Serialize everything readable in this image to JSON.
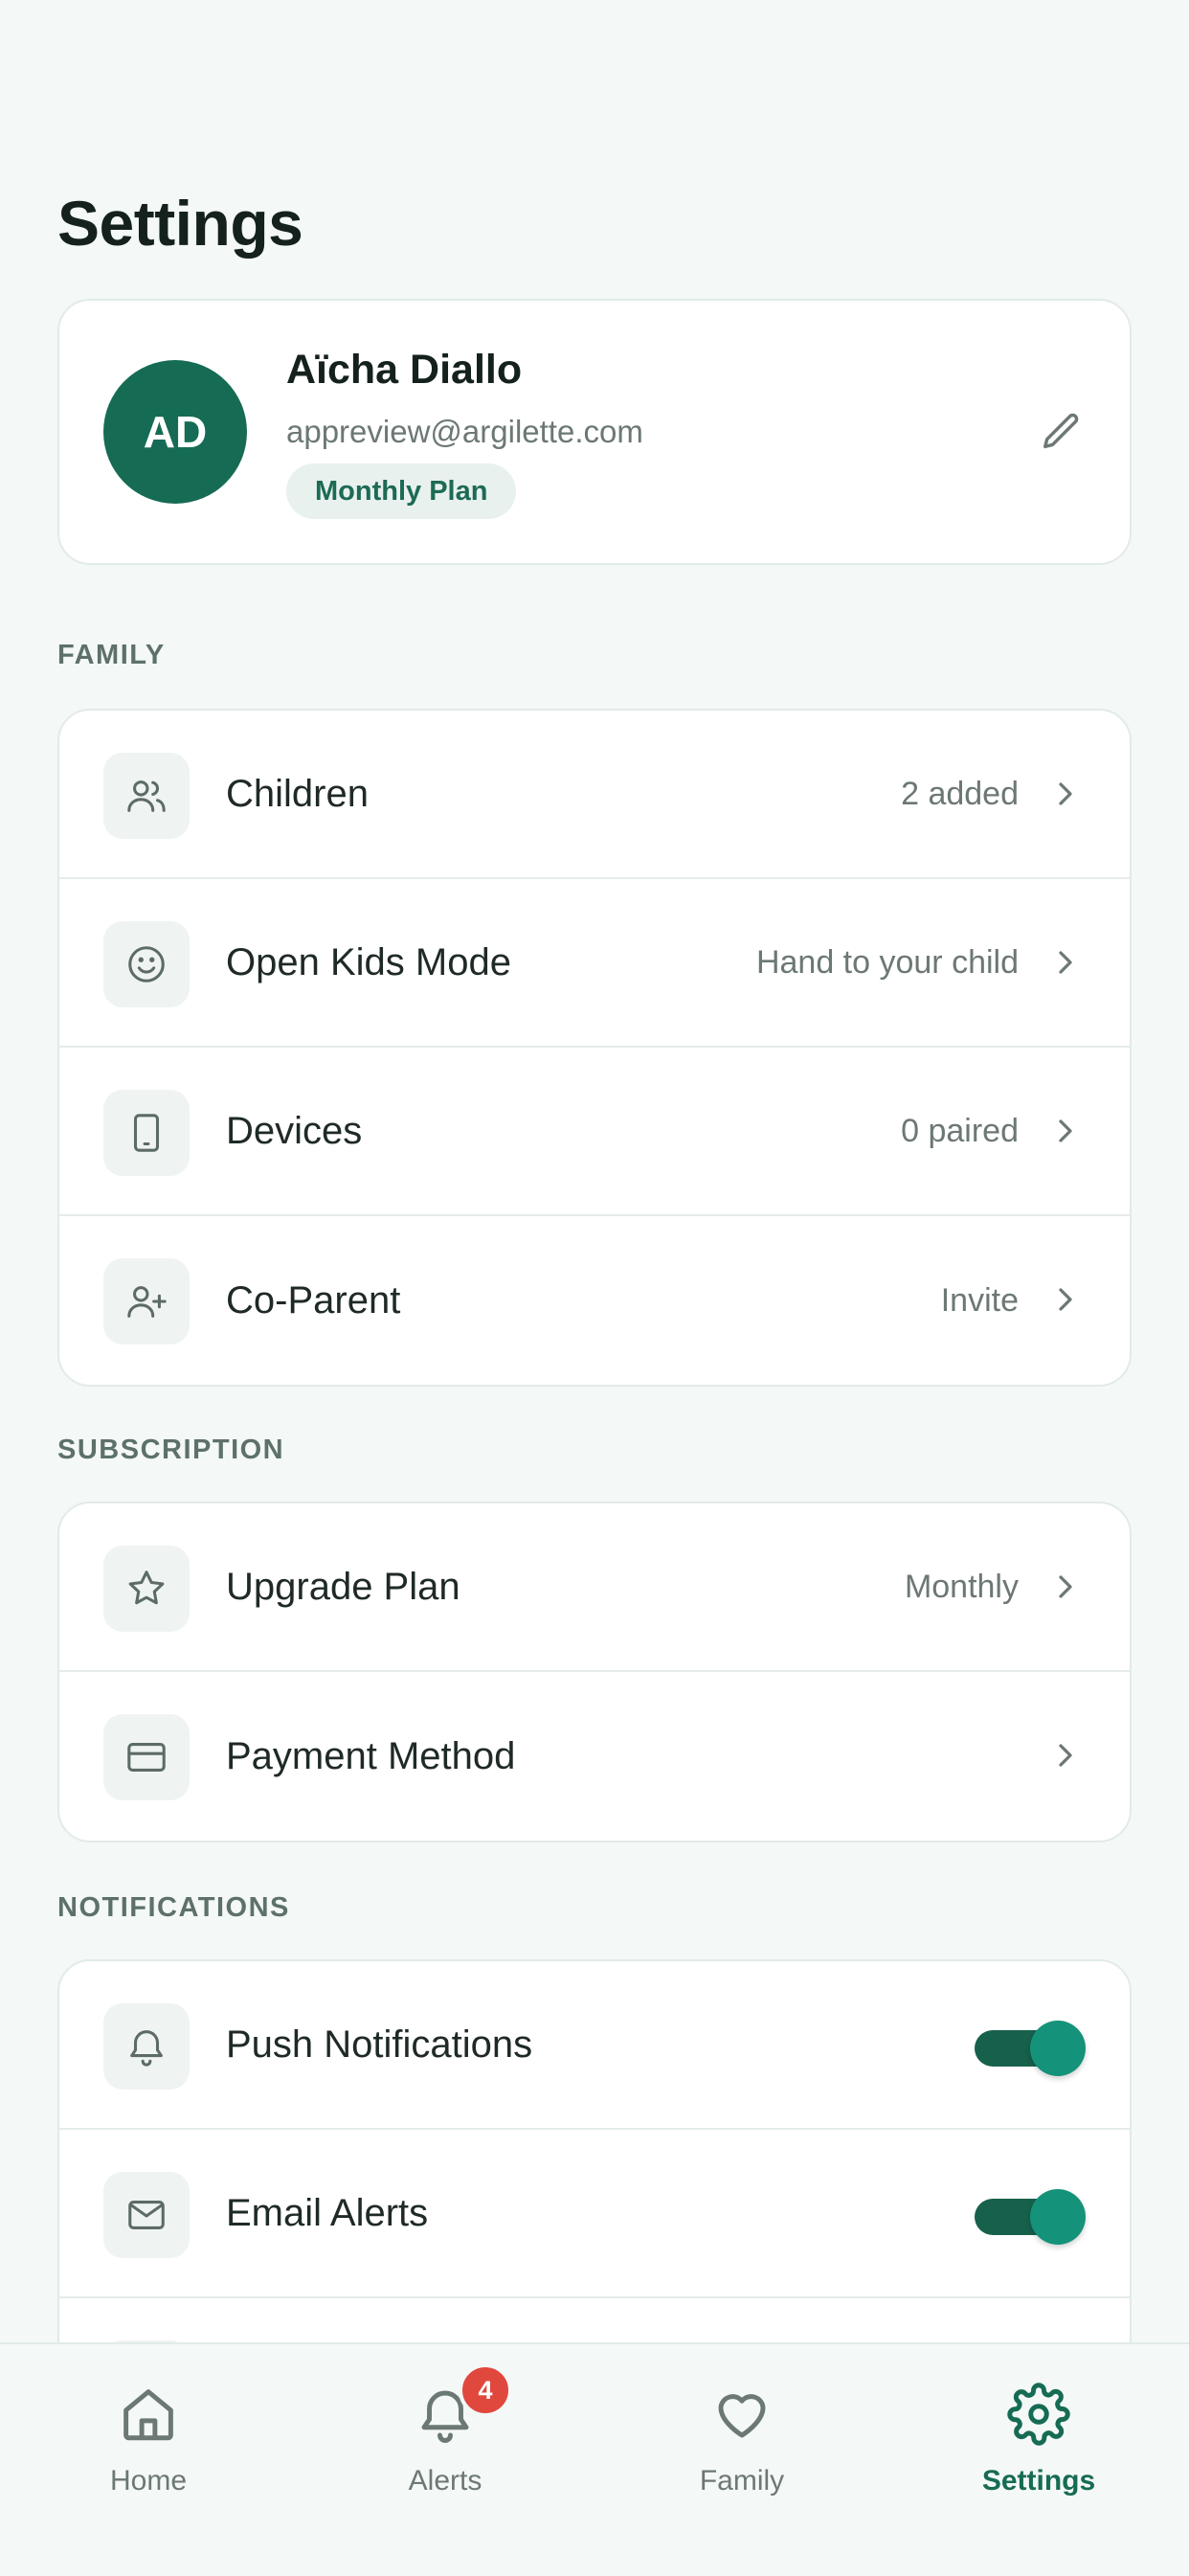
{
  "page": {
    "title": "Settings"
  },
  "profile": {
    "initials": "AD",
    "name": "Aïcha Diallo",
    "email": "appreview@argilette.com",
    "plan_badge": "Monthly Plan"
  },
  "family": {
    "label": "FAMILY",
    "items": [
      {
        "label": "Children",
        "value": "2 added",
        "icon": "users-icon"
      },
      {
        "label": "Open Kids Mode",
        "value": "Hand to your child",
        "icon": "smile-icon"
      },
      {
        "label": "Devices",
        "value": "0 paired",
        "icon": "tablet-icon"
      },
      {
        "label": "Co-Parent",
        "value": "Invite",
        "icon": "user-plus-icon"
      }
    ]
  },
  "subscription": {
    "label": "SUBSCRIPTION",
    "items": [
      {
        "label": "Upgrade Plan",
        "value": "Monthly",
        "icon": "star-icon"
      },
      {
        "label": "Payment Method",
        "value": "",
        "icon": "credit-card-icon"
      }
    ]
  },
  "notifications": {
    "label": "NOTIFICATIONS",
    "items": [
      {
        "label": "Push Notifications",
        "enabled": true,
        "icon": "bell-icon"
      },
      {
        "label": "Email Alerts",
        "enabled": true,
        "icon": "mail-icon"
      }
    ]
  },
  "tabbar": {
    "tabs": [
      {
        "label": "Home",
        "icon": "home-icon",
        "active": false
      },
      {
        "label": "Alerts",
        "icon": "bell-icon",
        "active": false,
        "badge": "4"
      },
      {
        "label": "Family",
        "icon": "heart-icon",
        "active": false
      },
      {
        "label": "Settings",
        "icon": "gear-icon",
        "active": true
      }
    ]
  },
  "colors": {
    "accent": "#166b54",
    "toggle_on": "#14927a",
    "badge": "#e0483e",
    "background": "#f4f8f6"
  }
}
